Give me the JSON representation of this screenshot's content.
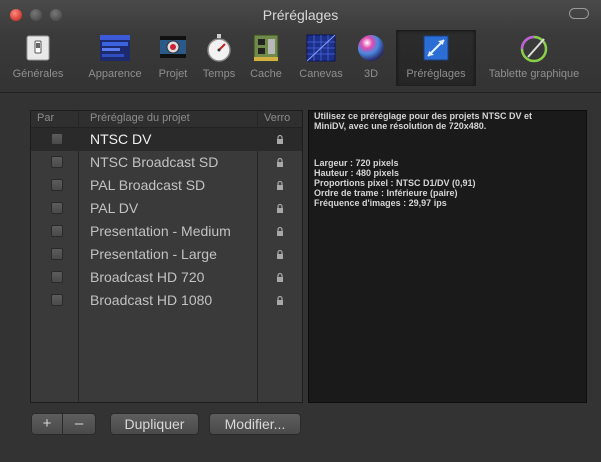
{
  "window": {
    "title": "Préréglages"
  },
  "toolbar": {
    "items": [
      {
        "label": "Générales",
        "icon": "switch-icon"
      },
      {
        "label": "Apparence",
        "icon": "appearance-icon"
      },
      {
        "label": "Projet",
        "icon": "film-icon"
      },
      {
        "label": "Temps",
        "icon": "stopwatch-icon"
      },
      {
        "label": "Cache",
        "icon": "memory-icon"
      },
      {
        "label": "Canevas",
        "icon": "canvas-grid-icon"
      },
      {
        "label": "3D",
        "icon": "sphere-icon"
      },
      {
        "label": "Préréglages",
        "icon": "presets-icon"
      },
      {
        "label": "Tablette graphique",
        "icon": "pen-tablet-icon"
      }
    ],
    "active": "Préréglages"
  },
  "table": {
    "headers": {
      "col1": "Par",
      "col2": "Préréglage du projet",
      "col3": "Verro"
    },
    "rows": [
      {
        "name": "NTSC DV",
        "checked": false,
        "locked": true,
        "selected": true
      },
      {
        "name": "NTSC Broadcast SD",
        "checked": false,
        "locked": true
      },
      {
        "name": "PAL Broadcast SD",
        "checked": false,
        "locked": true
      },
      {
        "name": "PAL DV",
        "checked": false,
        "locked": true
      },
      {
        "name": "Presentation - Medium",
        "checked": false,
        "locked": true
      },
      {
        "name": "Presentation - Large",
        "checked": false,
        "locked": true
      },
      {
        "name": "Broadcast HD 720",
        "checked": false,
        "locked": true
      },
      {
        "name": "Broadcast HD 1080",
        "checked": false,
        "locked": true
      }
    ]
  },
  "info": {
    "line1": "Utilisez ce préréglage pour des projets NTSC DV et",
    "line2": "MiniDV, avec une résolution de 720x480.",
    "details": [
      "Largeur : 720 pixels",
      "Hauteur : 480 pixels",
      "Proportions pixel : NTSC D1/DV (0,91)",
      "Ordre de trame : Inférieure (paire)",
      "Fréquence d'images : 29,97 ips"
    ]
  },
  "buttons": {
    "add": "+",
    "remove": "–",
    "duplicate": "Dupliquer",
    "modify": "Modifier..."
  },
  "colors": {
    "window_bg": "#333333",
    "info_bg": "#1a1a1a",
    "close_red": "#d8443a"
  }
}
